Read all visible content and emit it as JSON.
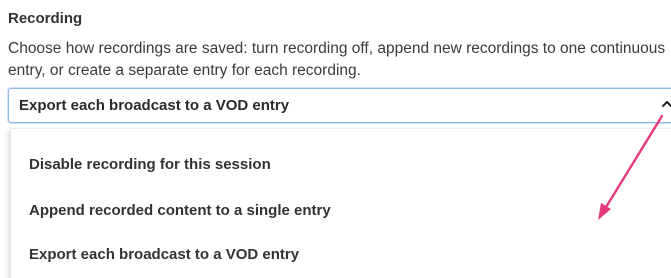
{
  "recording": {
    "title": "Recording",
    "description": "Choose how recordings are saved: turn recording off, append new recordings to one continuous entry, or create a separate entry for each recording.",
    "selected_value": "Export each broadcast to a VOD entry",
    "options": [
      {
        "label": "Disable recording for this session"
      },
      {
        "label": "Append recorded content to a single entry"
      },
      {
        "label": "Export each broadcast to a VOD entry"
      }
    ],
    "chevron_icon": "chevron-up-icon"
  },
  "annotation": {
    "arrow_icon": "arrow-annotation-icon",
    "arrow_color": "#e8387f"
  },
  "colors": {
    "select_border": "#8fb8e0",
    "text": "#333333"
  }
}
